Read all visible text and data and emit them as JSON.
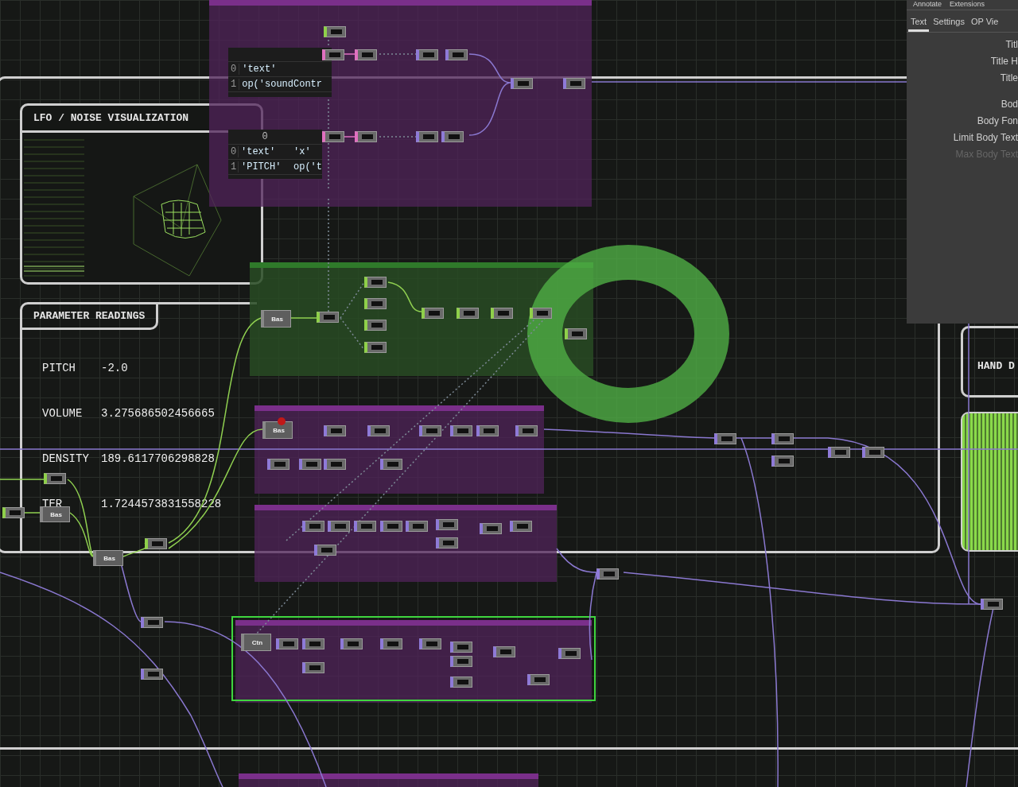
{
  "lfo_panel": {
    "title": "LFO / NOISE VISUALIZATION"
  },
  "readings_panel": {
    "title": "PARAMETER READINGS",
    "rows": [
      {
        "label": "PITCH",
        "value": "-2.0"
      },
      {
        "label": "VOLUME",
        "value": "3.275686502456665"
      },
      {
        "label": "DENSITY",
        "value": "189.6117706298828"
      },
      {
        "label": "TER",
        "value": "1.7244573831558228"
      }
    ]
  },
  "hand_panel": {
    "title": "HAND D"
  },
  "tables": [
    {
      "rows": [
        [
          "0",
          "'text'"
        ],
        [
          "1",
          "op('soundContr"
        ]
      ]
    },
    {
      "header": [
        "0"
      ],
      "rows": [
        [
          "0",
          "'text'",
          "'x'"
        ],
        [
          "1",
          "'PITCH'",
          "op('t"
        ]
      ]
    }
  ],
  "nodes": [
    {
      "label": "Bas"
    },
    {
      "label": "Bas"
    },
    {
      "label": "Bas"
    },
    {
      "label": "Bas"
    },
    {
      "label": "Ctn"
    }
  ],
  "parameter_panel": {
    "menu": [
      "Annotate",
      "Extensions"
    ],
    "tabs": [
      {
        "label": "Text",
        "selected": true
      },
      {
        "label": "Settings",
        "selected": false
      },
      {
        "label": "OP Vie",
        "selected": false
      }
    ],
    "params": [
      {
        "label": "Titl",
        "disabled": false
      },
      {
        "label": "Title H",
        "disabled": false
      },
      {
        "label": "Title",
        "disabled": false
      },
      {
        "label": "Bod",
        "disabled": false
      },
      {
        "label": "Body Fon",
        "disabled": false
      },
      {
        "label": "Limit Body Text",
        "disabled": false
      },
      {
        "label": "Max Body Text",
        "disabled": true
      }
    ]
  }
}
